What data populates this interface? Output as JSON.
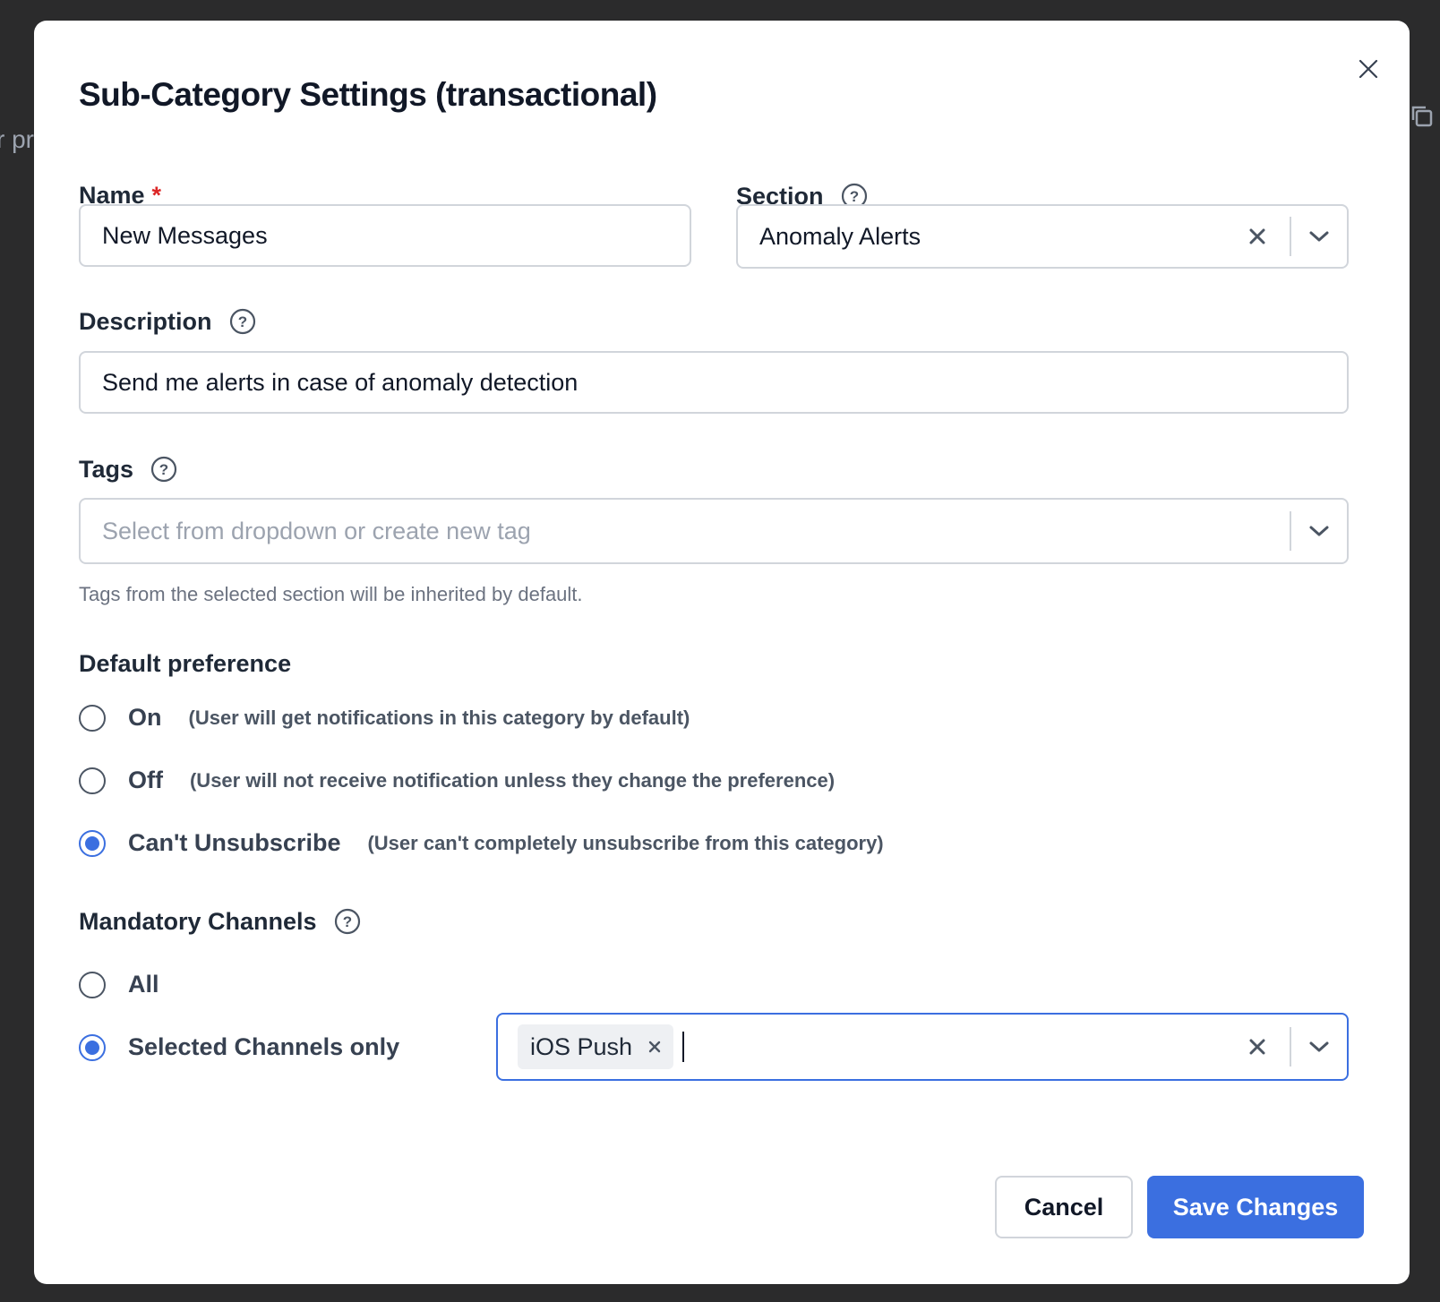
{
  "background": {
    "partial_text": "r pr"
  },
  "modal": {
    "title": "Sub-Category Settings (transactional)"
  },
  "name_field": {
    "label": "Name",
    "required_mark": "*",
    "value": "New Messages"
  },
  "section_field": {
    "label": "Section",
    "value": "Anomaly Alerts"
  },
  "description_field": {
    "label": "Description",
    "value": "Send me alerts in case of anomaly detection"
  },
  "tags_field": {
    "label": "Tags",
    "placeholder": "Select from dropdown or create new tag",
    "hint": "Tags from the selected section will be inherited by default."
  },
  "default_preference": {
    "label": "Default preference",
    "options": [
      {
        "label": "On",
        "description": "(User will get notifications in this category by default)",
        "checked": false
      },
      {
        "label": "Off",
        "description": "(User will not receive notification unless they change the preference)",
        "checked": false
      },
      {
        "label": "Can't Unsubscribe",
        "description": "(User can't completely unsubscribe from this category)",
        "checked": true
      }
    ]
  },
  "mandatory_channels": {
    "label": "Mandatory Channels",
    "options": [
      {
        "label": "All",
        "checked": false
      },
      {
        "label": "Selected Channels only",
        "checked": true
      }
    ],
    "selected_chips": [
      "iOS Push"
    ]
  },
  "footer": {
    "cancel_label": "Cancel",
    "save_label": "Save Changes"
  },
  "colors": {
    "accent": "#3b6fe0",
    "required": "#dc2626",
    "overlay": "#2b2b2c"
  },
  "icons": {
    "close": "close-icon",
    "help": "help-circle-icon",
    "clear": "clear-x-icon",
    "chevron": "chevron-down-icon"
  }
}
